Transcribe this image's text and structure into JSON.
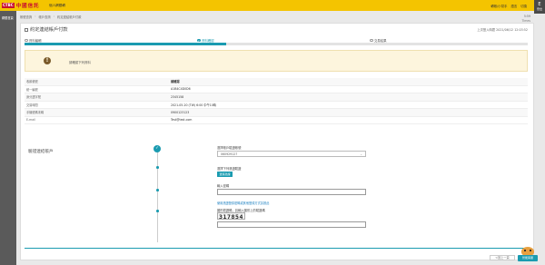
{
  "header": {
    "bank_logo_abbr": "CTBC",
    "bank_name": "中國信託",
    "nav_tab": "個人網銀轉",
    "top_links": [
      "轉帳/小幫手",
      "語言",
      "切換"
    ],
    "logout_label": "登出",
    "brand_color": "#f4c400"
  },
  "sidebar": {
    "items": [
      {
        "label": "網銀首頁"
      }
    ]
  },
  "breadcrumb": {
    "items": [
      "帳號查詢",
      "帳戶查詢",
      "約定連結帳戶付款"
    ],
    "right_text": "5:59",
    "right_sub": "Times"
  },
  "page": {
    "title": "約定連結帳戶付款",
    "login_time": "上次登入時間 2021/06/12 12:03:52"
  },
  "steps": {
    "items": [
      {
        "label": "資料編輯",
        "state": "done"
      },
      {
        "label": "資料確認",
        "state": "active"
      },
      {
        "label": "交易結果",
        "state": "pending"
      }
    ],
    "progress_fraction": 0.4,
    "accent_color": "#1a9bb0"
  },
  "alert": {
    "icon": "exclamation-icon",
    "text": "請確認下列資料"
  },
  "info_rows": [
    {
      "label": "收款帳號",
      "value": "請確認"
    },
    {
      "label": "統一編號",
      "value": "A1B4C4D0D6"
    },
    {
      "label": "身分證字號",
      "value": "2345158"
    },
    {
      "label": "交易時間",
      "value": "2021-05-20 (TW) 6:00 中午10時"
    },
    {
      "label": "手機號碼末碼",
      "value": "0900123123"
    },
    {
      "label": "E-mail",
      "value": "Test@test.com"
    }
  ],
  "agreement": {
    "section_title": "驗證連結帳戶",
    "account_label": "選擇帳戶驗證帳號",
    "account_value": "060929127",
    "cert_label": "選擇下列憑證驗證",
    "cert_button": "選擇憑證",
    "pin_label": "輸入密碼",
    "help_link": "使用憑證登錄密碼或其他登錄方式請按此",
    "captcha_label": "圖形驗證碼，請輸入圖形上的驗證碼",
    "captcha_value": "317854"
  },
  "footer": {
    "prev_button": "<回上一頁",
    "help_button": "智能客服"
  }
}
